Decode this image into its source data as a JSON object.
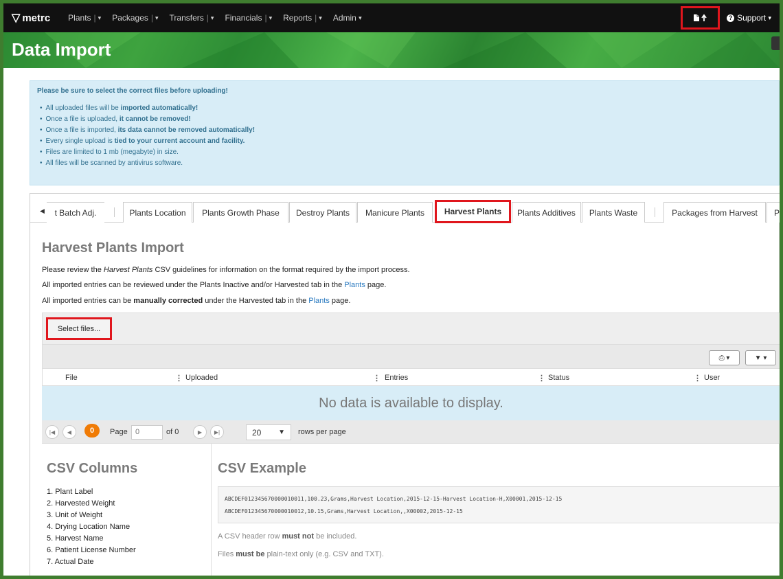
{
  "nav": {
    "logo": "metrc",
    "items": [
      {
        "label": "Plants",
        "has_sep": true
      },
      {
        "label": "Packages",
        "has_sep": true
      },
      {
        "label": "Transfers",
        "has_sep": true
      },
      {
        "label": "Financials",
        "has_sep": true
      },
      {
        "label": "Reports",
        "has_sep": true
      },
      {
        "label": "Admin",
        "has_sep": false
      }
    ],
    "support_label": "Support"
  },
  "page": {
    "title": "Data Import"
  },
  "alert": {
    "lead": "Please be sure to select the correct files before uploading!",
    "items": [
      {
        "pre": "All uploaded files will be ",
        "bold": "imported automatically!",
        "post": ""
      },
      {
        "pre": "Once a file is uploaded, ",
        "bold": "it cannot be removed!",
        "post": ""
      },
      {
        "pre": "Once a file is imported, ",
        "bold": "its data cannot be removed automatically!",
        "post": ""
      },
      {
        "pre": "Every single upload is ",
        "bold": "tied to your current account and facility.",
        "post": ""
      },
      {
        "pre": "Files are limited to 1 mb (megabyte) in size.",
        "bold": "",
        "post": ""
      },
      {
        "pre": "All files will be scanned by antivirus software.",
        "bold": "",
        "post": ""
      }
    ]
  },
  "tabs": [
    {
      "label": "t Batch Adj.",
      "active": false
    },
    {
      "label": "Plants Location",
      "active": false
    },
    {
      "label": "Plants Growth Phase",
      "active": false
    },
    {
      "label": "Destroy Plants",
      "active": false
    },
    {
      "label": "Manicure Plants",
      "active": false
    },
    {
      "label": "Harvest Plants",
      "active": true
    },
    {
      "label": "Plants Additives",
      "active": false
    },
    {
      "label": "Plants Waste",
      "active": false
    },
    {
      "label": "Packages from Harvest",
      "active": false
    },
    {
      "label": "Pa",
      "active": false
    }
  ],
  "section": {
    "title": "Harvest Plants Import",
    "line1": {
      "pre": "Please review the ",
      "italic": "Harvest Plants",
      "post": " CSV guidelines for information on the format required by the import process."
    },
    "line2": {
      "pre": "All imported entries can be reviewed under the Plants Inactive and/or Harvested tab in the ",
      "link": "Plants",
      "post": " page."
    },
    "line3": {
      "pre": "All imported entries can be ",
      "bold": "manually corrected",
      "mid": " under the Harvested tab in the ",
      "link": "Plants",
      "post": " page."
    }
  },
  "upload": {
    "select_label": "Select files..."
  },
  "grid": {
    "columns": [
      "File",
      "Uploaded",
      "Entries",
      "Status",
      "User"
    ],
    "empty_message": "No data is available to display."
  },
  "pager": {
    "count": "0",
    "page_label": "Page",
    "page_value": "0",
    "of_label": "of 0",
    "page_size": "20",
    "rows_label": "rows per page"
  },
  "csv": {
    "columns_title": "CSV Columns",
    "columns": [
      "1. Plant Label",
      "2. Harvested Weight",
      "3. Unit of Weight",
      "4. Drying Location Name",
      "5. Harvest Name",
      "6. Patient License Number",
      "7. Actual Date"
    ],
    "example_title": "CSV Example",
    "example_lines": [
      "ABCDEF012345670000010011,100.23,Grams,Harvest Location,2015-12-15-Harvest Location-H,X00001,2015-12-15",
      "ABCDEF012345670000010012,10.15,Grams,Harvest Location,,X00002,2015-12-15"
    ],
    "note1": {
      "pre": "A CSV header row ",
      "bold": "must not",
      "post": " be included."
    },
    "note2": {
      "pre": "Files ",
      "bold": "must be",
      "post": " plain-text only (e.g. CSV and TXT)."
    }
  },
  "icons": {
    "logo": "metrc-logo-icon",
    "upload": "file-upload-icon",
    "support": "question-circle-icon",
    "print": "print-icon",
    "filter": "filter-icon"
  },
  "colors": {
    "navbar": "#111111",
    "highlight": "#e0161d",
    "alert_bg": "#d8edf7",
    "badge": "#f07b05",
    "link": "#2a7ac0"
  }
}
